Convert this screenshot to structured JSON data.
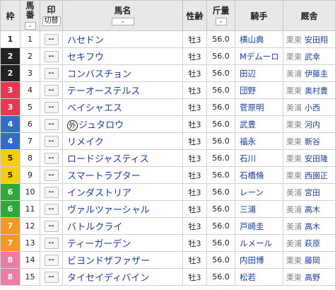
{
  "header": {
    "waku": "枠",
    "umaban": "馬\n番",
    "mark": "印",
    "kirikae": "切替",
    "horse": "馬名",
    "sex_age": "性齢",
    "weight": "斤量",
    "jockey": "騎手",
    "trainer": "厩舎",
    "sort_glyph": "⌄"
  },
  "waku_colors": {
    "1": {
      "bg": "#ffffff",
      "fg": "#222222"
    },
    "2": {
      "bg": "#222222",
      "fg": "#ffffff"
    },
    "3": {
      "bg": "#e8384f",
      "fg": "#ffffff"
    },
    "4": {
      "bg": "#2f6fc9",
      "fg": "#ffffff"
    },
    "5": {
      "bg": "#f5d000",
      "fg": "#222222"
    },
    "6": {
      "bg": "#2fa83c",
      "fg": "#ffffff"
    },
    "7": {
      "bg": "#f39a1e",
      "fg": "#ffffff"
    },
    "8": {
      "bg": "#f07aa8",
      "fg": "#ffffff"
    }
  },
  "rows": [
    {
      "waku": "1",
      "num": "1",
      "mark": "--",
      "tag": "",
      "name": "ハセドン",
      "sex_age": "牡3",
      "weight": "56.0",
      "jockey": "横山典",
      "region": "栗東",
      "trainer": "安田翔"
    },
    {
      "waku": "2",
      "num": "2",
      "mark": "--",
      "tag": "",
      "name": "セキフウ",
      "sex_age": "牡3",
      "weight": "56.0",
      "jockey": "Mデムーロ",
      "region": "栗東",
      "trainer": "武幸"
    },
    {
      "waku": "2",
      "num": "3",
      "mark": "--",
      "tag": "",
      "name": "コンバスチョン",
      "sex_age": "牡3",
      "weight": "56.0",
      "jockey": "田辺",
      "region": "美浦",
      "trainer": "伊藤圭"
    },
    {
      "waku": "3",
      "num": "4",
      "mark": "--",
      "tag": "",
      "name": "テーオーステルス",
      "sex_age": "牡3",
      "weight": "56.0",
      "jockey": "団野",
      "region": "栗東",
      "trainer": "奥村豊"
    },
    {
      "waku": "3",
      "num": "5",
      "mark": "--",
      "tag": "",
      "name": "ベイシャエス",
      "sex_age": "牡3",
      "weight": "56.0",
      "jockey": "菅原明",
      "region": "美浦",
      "trainer": "小西"
    },
    {
      "waku": "4",
      "num": "6",
      "mark": "--",
      "tag": "外",
      "name": "ジュタロウ",
      "sex_age": "牡3",
      "weight": "56.0",
      "jockey": "武豊",
      "region": "栗東",
      "trainer": "河内"
    },
    {
      "waku": "4",
      "num": "7",
      "mark": "--",
      "tag": "",
      "name": "リメイク",
      "sex_age": "牡3",
      "weight": "56.0",
      "jockey": "福永",
      "region": "栗東",
      "trainer": "新谷"
    },
    {
      "waku": "5",
      "num": "8",
      "mark": "--",
      "tag": "",
      "name": "ロードジャスティス",
      "sex_age": "牡3",
      "weight": "56.0",
      "jockey": "石川",
      "region": "栗東",
      "trainer": "安田隆"
    },
    {
      "waku": "5",
      "num": "9",
      "mark": "--",
      "tag": "",
      "name": "スマートラプター",
      "sex_age": "牡3",
      "weight": "56.0",
      "jockey": "石橋脩",
      "region": "栗東",
      "trainer": "西園正"
    },
    {
      "waku": "6",
      "num": "10",
      "mark": "--",
      "tag": "",
      "name": "インダストリア",
      "sex_age": "牡3",
      "weight": "56.0",
      "jockey": "レーン",
      "region": "美浦",
      "trainer": "宮田"
    },
    {
      "waku": "6",
      "num": "11",
      "mark": "--",
      "tag": "",
      "name": "ヴァルツァーシャル",
      "sex_age": "牡3",
      "weight": "56.0",
      "jockey": "三浦",
      "region": "美浦",
      "trainer": "高木"
    },
    {
      "waku": "7",
      "num": "12",
      "mark": "--",
      "tag": "",
      "name": "バトルクライ",
      "sex_age": "牡3",
      "weight": "56.0",
      "jockey": "戸崎圭",
      "region": "美浦",
      "trainer": "高木"
    },
    {
      "waku": "7",
      "num": "13",
      "mark": "--",
      "tag": "",
      "name": "ティーガーデン",
      "sex_age": "牡3",
      "weight": "56.0",
      "jockey": "ルメール",
      "region": "美浦",
      "trainer": "萩原"
    },
    {
      "waku": "8",
      "num": "14",
      "mark": "--",
      "tag": "",
      "name": "ビヨンドザファザー",
      "sex_age": "牡3",
      "weight": "56.0",
      "jockey": "内田博",
      "region": "栗東",
      "trainer": "藤岡"
    },
    {
      "waku": "8",
      "num": "15",
      "mark": "--",
      "tag": "",
      "name": "タイセイディバイン",
      "sex_age": "牡3",
      "weight": "56.0",
      "jockey": "松若",
      "region": "栗東",
      "trainer": "高野"
    }
  ]
}
